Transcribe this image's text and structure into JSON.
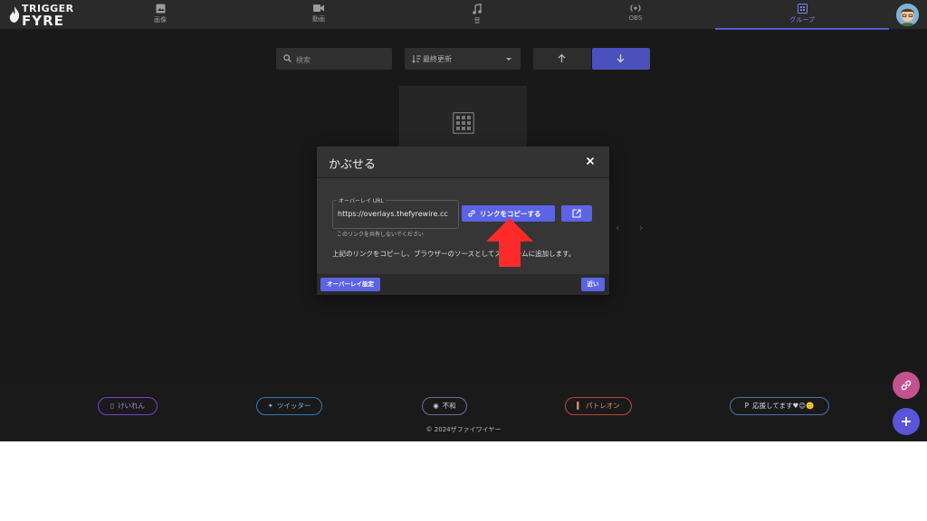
{
  "brand": {
    "line1": "TRIGGER",
    "line2": "FYRE"
  },
  "nav": {
    "items": [
      {
        "label": "画像",
        "icon": "image-icon"
      },
      {
        "label": "動画",
        "icon": "video-icon"
      },
      {
        "label": "音",
        "icon": "music-note-icon"
      },
      {
        "label": "OBS",
        "icon": "broadcast-icon"
      },
      {
        "label": "グループ",
        "icon": "group-grid-icon"
      }
    ],
    "active": "グループ"
  },
  "filters": {
    "search_placeholder": "検索",
    "sort_value": "最終更新"
  },
  "modal": {
    "title": "かぶせる",
    "field_label": "オーバーレイ URL",
    "url_value": "https://overlays.thefyrewire.cc",
    "hint": "このリンクを共有しないでください",
    "copy_button": "リンクをコピーする",
    "description": "上記のリンクをコピーし、ブラウザーのソースとしてストリームに追加します。",
    "overlay_settings_button": "オーバーレイ設定",
    "close_button": "近い"
  },
  "footer": {
    "links": [
      {
        "label": "けいれん",
        "icon": "twitch-icon"
      },
      {
        "label": "ツイッター",
        "icon": "twitter-icon"
      },
      {
        "label": "不和",
        "icon": "discord-icon"
      },
      {
        "label": "パトレオン",
        "icon": "patreon-icon"
      },
      {
        "label": "応援してます♥😊🙂",
        "icon": "paypal-icon"
      }
    ],
    "copyright": "© 2024ザファイワイヤー"
  },
  "colors": {
    "accent": "#5b63e6",
    "background": "#1f1f1f",
    "highlight_arrow": "#ff2a2a"
  }
}
